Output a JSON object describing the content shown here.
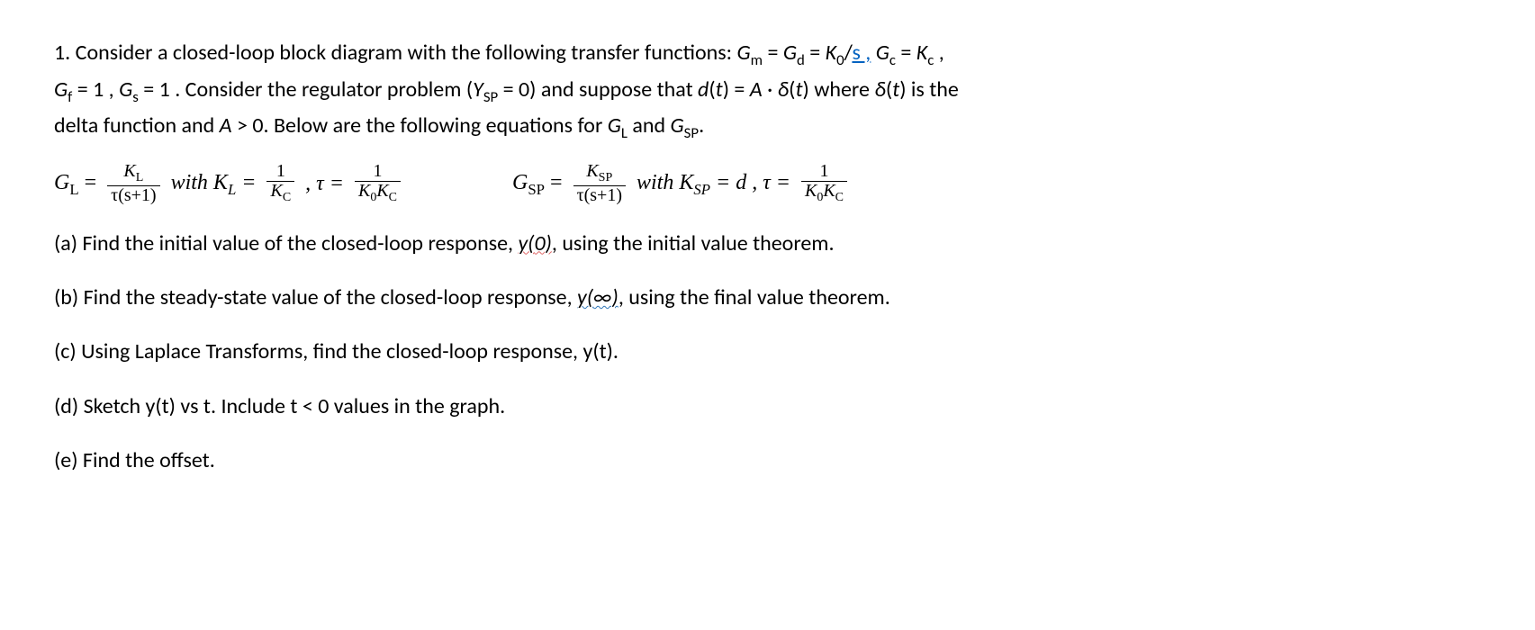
{
  "problem": {
    "number": "1.",
    "intro_a": "Consider a closed-loop block diagram with the following transfer functions: ",
    "tf": {
      "gm_eq": "Gₘ = G_d = K₀/",
      "s_link": "s ,",
      "gc_eq": " G_c = K_c ,",
      "gf_gs": "G_f = 1 ,  G_s = 1 . Consider the regulator problem (Y_SP = 0) and suppose that d(t) = A · δ(t) where δ(t) is the delta function and A > 0. Below are the following equations for G_L and G_SP."
    }
  },
  "eq": {
    "GL": {
      "lhs": "G",
      "lhs_sub": "L",
      "eq": " = ",
      "num": "K",
      "num_sub": "L",
      "den_a": "τ(s+1)",
      "with": " with K",
      "with_sub": "L",
      "eq2": " = ",
      "kl_num": "1",
      "kl_den_a": "K",
      "kl_den_sub": "C",
      "comma": " , τ = ",
      "tau_num": "1",
      "tau_den_a": "K",
      "tau_den_sub0": "0",
      "tau_den_b": "K",
      "tau_den_subC": "C"
    },
    "GSP": {
      "lhs": "G",
      "lhs_sub": "SP",
      "eq": " = ",
      "num": "K",
      "num_sub": "SP",
      "den_a": "τ(s+1)",
      "with": " with K",
      "with_sub": "SP",
      "eq2": " = d , τ = ",
      "tau_num": "1",
      "tau_den_a": "K",
      "tau_den_sub0": "0",
      "tau_den_b": "K",
      "tau_den_subC": "C"
    }
  },
  "parts": {
    "a_pre": "(a) Find the initial value of the closed-loop response, ",
    "a_y0": "y(",
    "a_y0b": "0)",
    "a_post": ", using the initial value theorem.",
    "b_pre": "(b) Find the steady-state value of the closed-loop response, ",
    "b_yinf": "y(",
    "b_yinfb": "∞)",
    "b_post": ", using the final value theorem.",
    "c": "(c) Using Laplace Transforms, find the closed-loop response, y(t).",
    "d": "(d) Sketch y(t) vs t. Include t < 0 values in the graph.",
    "e": "(e)  Find the offset."
  }
}
